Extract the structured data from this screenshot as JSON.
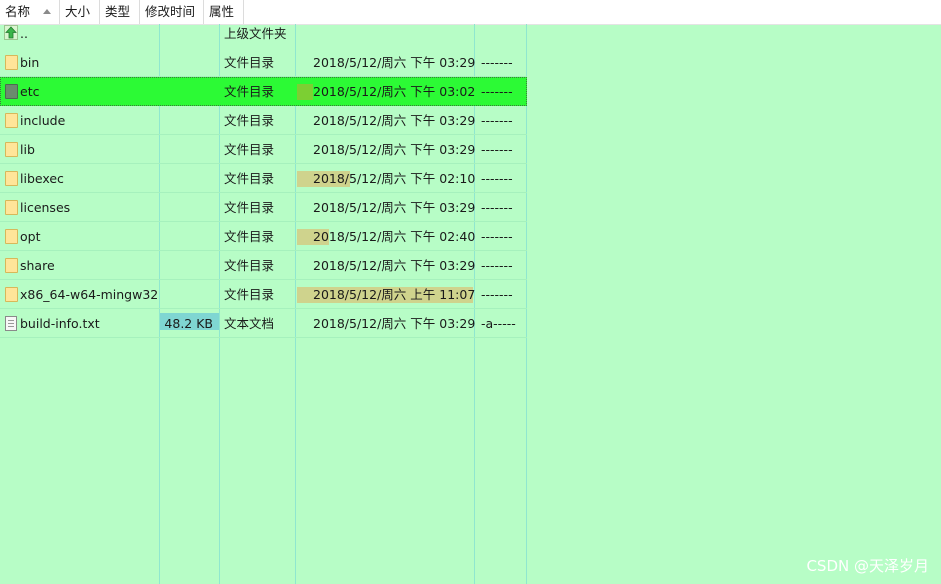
{
  "columns": {
    "name": "名称",
    "size": "大小",
    "type": "类型",
    "modified": "修改时间",
    "attributes": "属性"
  },
  "parent_entry": {
    "name": "..",
    "type": "上级文件夹"
  },
  "rows": [
    {
      "name": "bin",
      "icon": "folder-icon",
      "size": "",
      "type": "文件目录",
      "modified": "2018/5/12/周六  下午 03:29",
      "attr": "-------",
      "age_bar": 0
    },
    {
      "name": "etc",
      "icon": "folder-icon",
      "size": "",
      "type": "文件目录",
      "modified": "2018/5/12/周六  下午 03:02",
      "attr": "-------",
      "age_bar": 0.09,
      "selected": true
    },
    {
      "name": "include",
      "icon": "folder-icon",
      "size": "",
      "type": "文件目录",
      "modified": "2018/5/12/周六  下午 03:29",
      "attr": "-------",
      "age_bar": 0
    },
    {
      "name": "lib",
      "icon": "folder-icon",
      "size": "",
      "type": "文件目录",
      "modified": "2018/5/12/周六  下午 03:29",
      "attr": "-------",
      "age_bar": 0
    },
    {
      "name": "libexec",
      "icon": "folder-icon",
      "size": "",
      "type": "文件目录",
      "modified": "2018/5/12/周六  下午 02:10",
      "attr": "-------",
      "age_bar": 0.3
    },
    {
      "name": "licenses",
      "icon": "folder-icon",
      "size": "",
      "type": "文件目录",
      "modified": "2018/5/12/周六  下午 03:29",
      "attr": "-------",
      "age_bar": 0
    },
    {
      "name": "opt",
      "icon": "folder-icon",
      "size": "",
      "type": "文件目录",
      "modified": "2018/5/12/周六  下午 02:40",
      "attr": "-------",
      "age_bar": 0.18
    },
    {
      "name": "share",
      "icon": "folder-icon",
      "size": "",
      "type": "文件目录",
      "modified": "2018/5/12/周六  下午 03:29",
      "attr": "-------",
      "age_bar": 0
    },
    {
      "name": "x86_64-w64-mingw32",
      "icon": "folder-icon",
      "size": "",
      "type": "文件目录",
      "modified": "2018/5/12/周六  上午 11:07",
      "attr": "-------",
      "age_bar": 1.0
    },
    {
      "name": "build-info.txt",
      "icon": "file-icon",
      "size": "48.2 KB",
      "type": "文本文档",
      "modified": "2018/5/12/周六  下午 03:29",
      "attr": "-a-----",
      "age_bar": 0
    }
  ],
  "watermark": "CSDN @天泽岁月",
  "colors": {
    "background": "#b7fdc6",
    "selected_row": "#2cfa35",
    "size_highlight": "#7fd6d2",
    "age_highlight": "#cfd38d",
    "column_guide": "#8fe7cf"
  }
}
